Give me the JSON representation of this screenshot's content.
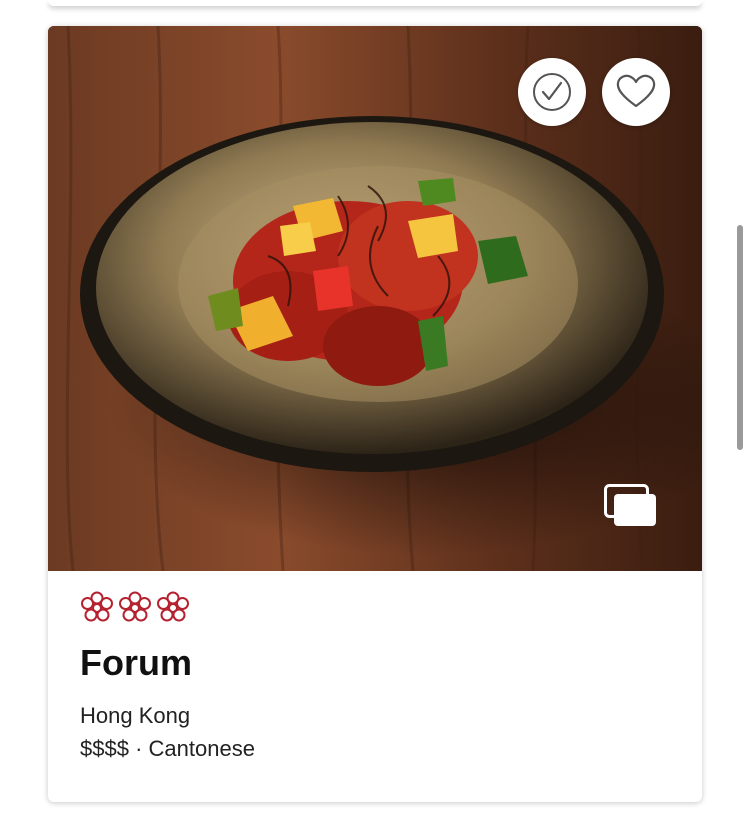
{
  "restaurant": {
    "name": "Forum",
    "location": "Hong Kong",
    "price": "$$$$",
    "separator": "·",
    "cuisine": "Cantonese",
    "distinction_stars": 3
  },
  "icons": {
    "visited": "check-circle-icon",
    "favorite": "heart-icon",
    "gallery": "photo-gallery-icon",
    "star": "michelin-star-icon"
  },
  "colors": {
    "star": "#b5222f",
    "text": "#111111",
    "icon": "#555555"
  }
}
